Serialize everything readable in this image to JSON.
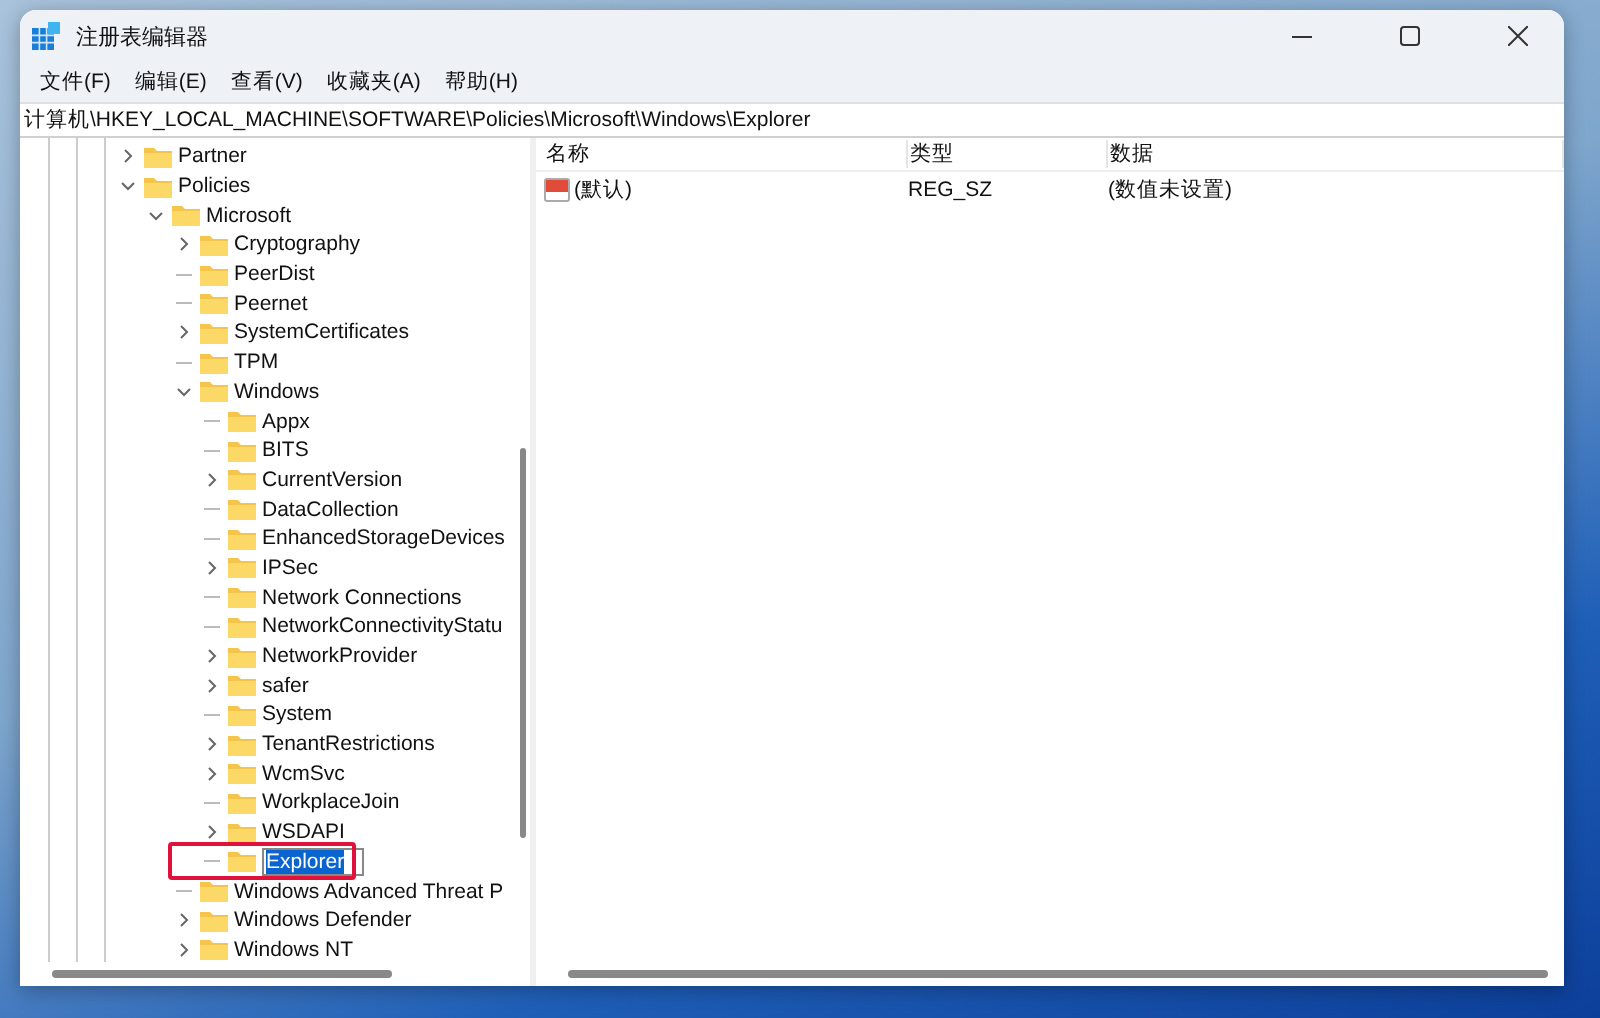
{
  "window": {
    "title": "注册表编辑器"
  },
  "menu": [
    "文件(F)",
    "编辑(E)",
    "查看(V)",
    "收藏夹(A)",
    "帮助(H)"
  ],
  "address": "计算机\\HKEY_LOCAL_MACHINE\\SOFTWARE\\Policies\\Microsoft\\Windows\\Explorer",
  "tree": [
    {
      "label": "Partner",
      "kind": "collapsed",
      "editing": false
    },
    {
      "label": "Policies",
      "kind": "expanded",
      "editing": false,
      "children": [
        {
          "label": "Microsoft",
          "kind": "expanded",
          "editing": false,
          "children": [
            {
              "label": "Cryptography",
              "kind": "collapsed",
              "editing": false
            },
            {
              "label": "PeerDist",
              "kind": "leaf",
              "editing": false
            },
            {
              "label": "Peernet",
              "kind": "leaf",
              "editing": false
            },
            {
              "label": "SystemCertificates",
              "kind": "collapsed",
              "editing": false
            },
            {
              "label": "TPM",
              "kind": "leaf",
              "editing": false
            },
            {
              "label": "Windows",
              "kind": "expanded",
              "editing": false,
              "children": [
                {
                  "label": "Appx",
                  "kind": "leaf",
                  "editing": false
                },
                {
                  "label": "BITS",
                  "kind": "leaf",
                  "editing": false
                },
                {
                  "label": "CurrentVersion",
                  "kind": "collapsed",
                  "editing": false
                },
                {
                  "label": "DataCollection",
                  "kind": "leaf",
                  "editing": false
                },
                {
                  "label": "EnhancedStorageDevices",
                  "kind": "leaf",
                  "editing": false
                },
                {
                  "label": "IPSec",
                  "kind": "collapsed",
                  "editing": false
                },
                {
                  "label": "Network Connections",
                  "kind": "leaf",
                  "editing": false
                },
                {
                  "label": "NetworkConnectivityStatu",
                  "kind": "leaf",
                  "editing": false
                },
                {
                  "label": "NetworkProvider",
                  "kind": "collapsed",
                  "editing": false
                },
                {
                  "label": "safer",
                  "kind": "collapsed",
                  "editing": false
                },
                {
                  "label": "System",
                  "kind": "leaf",
                  "editing": false
                },
                {
                  "label": "TenantRestrictions",
                  "kind": "collapsed",
                  "editing": false
                },
                {
                  "label": "WcmSvc",
                  "kind": "collapsed",
                  "editing": false
                },
                {
                  "label": "WorkplaceJoin",
                  "kind": "leaf",
                  "editing": false
                },
                {
                  "label": "WSDAPI",
                  "kind": "collapsed",
                  "editing": false
                },
                {
                  "label": "Explorer",
                  "kind": "leaf",
                  "editing": true
                }
              ]
            },
            {
              "label": "Windows Advanced Threat P",
              "kind": "leaf",
              "editing": false
            },
            {
              "label": "Windows Defender",
              "kind": "collapsed",
              "editing": false
            },
            {
              "label": "Windows NT",
              "kind": "collapsed",
              "editing": false
            }
          ]
        }
      ]
    }
  ],
  "values": {
    "columns": [
      "名称",
      "类型",
      "数据"
    ],
    "rows": [
      {
        "name": "(默认)",
        "type": "REG_SZ",
        "data": "(数值未设置)"
      }
    ]
  }
}
